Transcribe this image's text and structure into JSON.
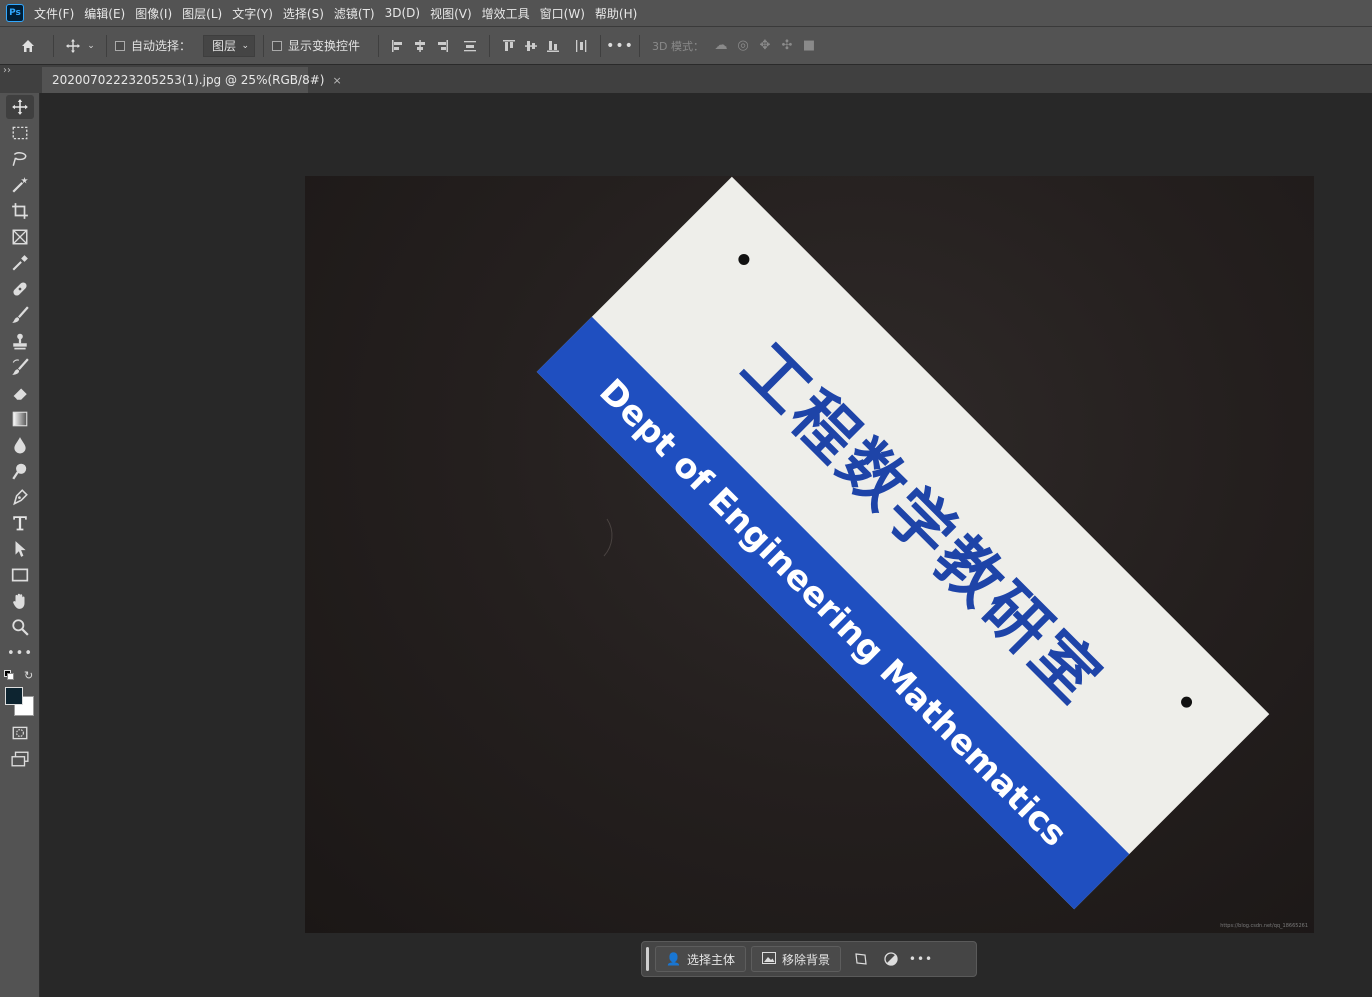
{
  "menubar": {
    "logo": "Ps",
    "items": [
      "文件(F)",
      "编辑(E)",
      "图像(I)",
      "图层(L)",
      "文字(Y)",
      "选择(S)",
      "滤镜(T)",
      "3D(D)",
      "视图(V)",
      "增效工具",
      "窗口(W)",
      "帮助(H)"
    ]
  },
  "options": {
    "auto_select_label": "自动选择：",
    "layer_dropdown_value": "图层",
    "show_transform_label": "显示变换控件",
    "mode_3d_label": "3D 模式："
  },
  "document": {
    "tab_title": "20200702223205253(1).jpg @ 25%(RGB/8#)",
    "close_glyph": "×"
  },
  "photo": {
    "sign_cn_text": "工程数学教研室",
    "sign_en_text": "Dept of Engineering Mathematics",
    "watermark": "https://blog.csdn.net/qq_18665261",
    "colors": {
      "sign_white": "#eeeeea",
      "sign_blue": "#1f4fc0",
      "text_blue": "#1e44a8",
      "background": "#241f1e"
    }
  },
  "taskbar": {
    "select_subject_label": "选择主体",
    "remove_bg_label": "移除背景",
    "more_glyph": "•••"
  },
  "tools": [
    "move-tool",
    "marquee-tool",
    "lasso-tool",
    "magic-wand-tool",
    "crop-tool",
    "frame-tool",
    "eyedropper-tool",
    "healing-brush-tool",
    "brush-tool",
    "stamp-tool",
    "history-brush-tool",
    "eraser-tool",
    "gradient-tool",
    "blur-tool",
    "dodge-tool",
    "pen-tool",
    "type-tool",
    "path-selection-tool",
    "rectangle-tool",
    "hand-tool",
    "zoom-tool",
    "edit-toolbar"
  ],
  "swatches": {
    "foreground": "#0d2430",
    "background": "#ffffff"
  }
}
